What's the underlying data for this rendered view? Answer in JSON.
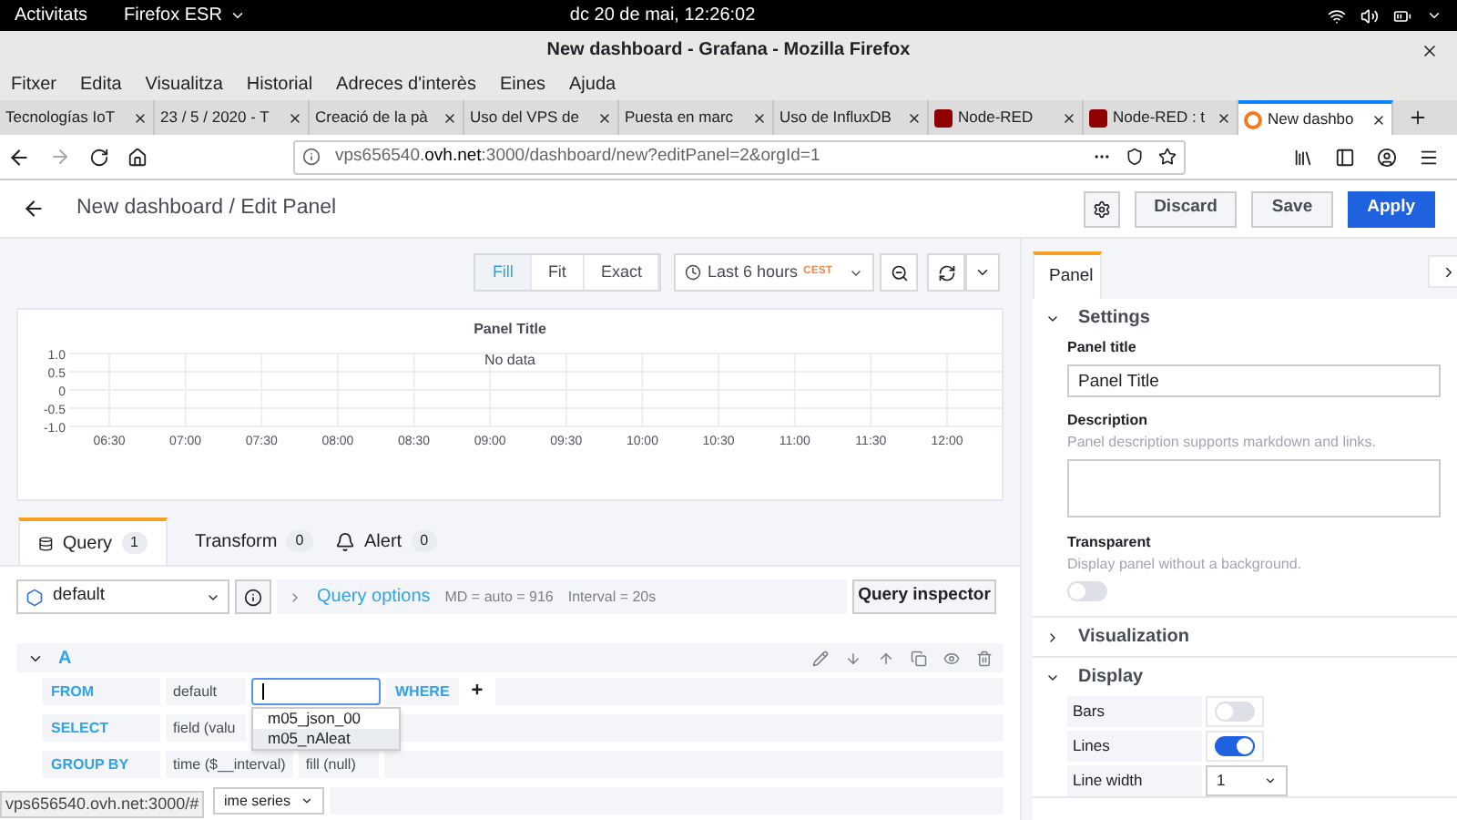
{
  "system_bar": {
    "activities": "Activitats",
    "app_menu": "Firefox ESR",
    "clock": "dc 20 de mai, 12:26:02"
  },
  "window": {
    "title": "New dashboard - Grafana - Mozilla Firefox"
  },
  "menu": [
    "Fitxer",
    "Edita",
    "Visualitza",
    "Historial",
    "Adreces d'interès",
    "Eines",
    "Ajuda"
  ],
  "tabs": [
    {
      "label": "Tecnologías IoT",
      "kind": "page",
      "selected": false
    },
    {
      "label": "23 / 5 / 2020 - T",
      "kind": "page",
      "selected": false
    },
    {
      "label": "Creació de la pà",
      "kind": "page",
      "selected": false
    },
    {
      "label": "Uso del VPS de",
      "kind": "page",
      "selected": false
    },
    {
      "label": "Puesta en marc",
      "kind": "page",
      "selected": false
    },
    {
      "label": "Uso de InfluxDB",
      "kind": "page",
      "selected": false
    },
    {
      "label": "Node-RED",
      "kind": "nodered",
      "selected": false
    },
    {
      "label": "Node-RED : t",
      "kind": "nodered",
      "selected": false
    },
    {
      "label": "New dashbo",
      "kind": "grafana",
      "selected": true
    }
  ],
  "url": {
    "host_pre": "vps656540.",
    "host_domain": "ovh.net",
    "rest": ":3000/dashboard/new?editPanel=2&orgId=1"
  },
  "header": {
    "title": "New dashboard / Edit Panel",
    "buttons": [
      "Discard",
      "Save",
      "Apply"
    ]
  },
  "toolbar": {
    "modes": [
      {
        "label": "Fill",
        "selected": true
      },
      {
        "label": "Fit",
        "selected": false
      },
      {
        "label": "Exact",
        "selected": false
      }
    ],
    "time_range": "Last 6 hours",
    "timezone": "CEST"
  },
  "panel": {
    "chart_data": {
      "type": "line",
      "title": "Panel Title",
      "ylim": [
        -1,
        1
      ],
      "yticks": [
        {
          "value": 1,
          "label": "1.0"
        },
        {
          "value": 0.5,
          "label": "0.5"
        },
        {
          "value": 0,
          "label": "0"
        },
        {
          "value": -0.5,
          "label": "-0.5"
        },
        {
          "value": -1,
          "label": "-1.0"
        }
      ],
      "categories": [
        "06:30",
        "07:00",
        "07:30",
        "08:00",
        "08:30",
        "09:00",
        "09:30",
        "10:00",
        "10:30",
        "11:00",
        "11:30",
        "12:00"
      ],
      "annotations": [
        "No data"
      ],
      "grid": true
    }
  },
  "query_tabs": [
    {
      "label": "Query",
      "count": "1",
      "kind": "query",
      "selected": true
    },
    {
      "label": "Transform",
      "count": "0",
      "kind": "transform",
      "selected": false
    },
    {
      "label": "Alert",
      "count": "0",
      "kind": "alert",
      "selected": false
    }
  ],
  "datasource": {
    "value": "default",
    "options_label": "Query options",
    "md": "MD = auto = 916",
    "interval": "Interval = 20s",
    "inspector": "Query inspector"
  },
  "query": {
    "name": "A",
    "expanded": true,
    "rows": [
      {
        "label": "FROM",
        "parts": [
          "default"
        ],
        "input": true,
        "where": "WHERE",
        "plus": "+"
      },
      {
        "label": "SELECT",
        "parts": [
          "field (valu"
        ]
      },
      {
        "label": "GROUP BY",
        "parts": [
          "time ($__interval)",
          "fill (null)"
        ]
      }
    ],
    "format_value": "ime series",
    "suggestions": [
      {
        "label": "m05_json_00",
        "selected": false
      },
      {
        "label": "m05_nAleat",
        "selected": true
      }
    ]
  },
  "status_url": "vps656540.ovh.net:3000/#",
  "options": {
    "tab": "Panel",
    "sections": [
      {
        "title": "Settings",
        "expanded": true,
        "kind": "settings"
      },
      {
        "title": "Visualization",
        "expanded": false,
        "kind": "plain"
      },
      {
        "title": "Display",
        "expanded": true,
        "kind": "display"
      }
    ],
    "panel_title_label": "Panel title",
    "panel_title_value": "Panel Title",
    "description_label": "Description",
    "description_hint": "Panel description supports markdown and links.",
    "transparent_label": "Transparent",
    "transparent_hint": "Display panel without a background.",
    "transparent_on": false,
    "display_rows": [
      {
        "label": "Bars",
        "kind": "switch",
        "on": false
      },
      {
        "label": "Lines",
        "kind": "switch",
        "on": true
      },
      {
        "label": "Line width",
        "kind": "select",
        "value": "1"
      }
    ]
  }
}
